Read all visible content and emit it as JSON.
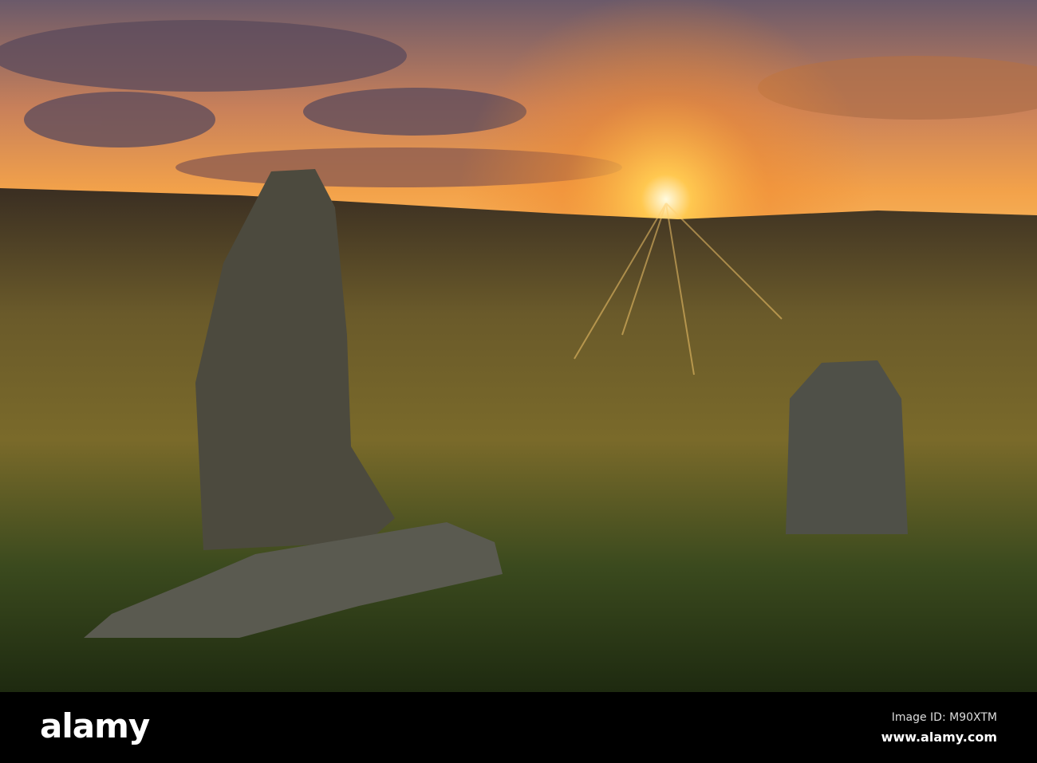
{
  "image": {
    "description_icon": "sunset-standing-stones-photo",
    "watermark": "alamy"
  },
  "footer": {
    "logo": "alamy",
    "image_id": "Image ID: M90XTM",
    "url": "www.alamy.com"
  }
}
